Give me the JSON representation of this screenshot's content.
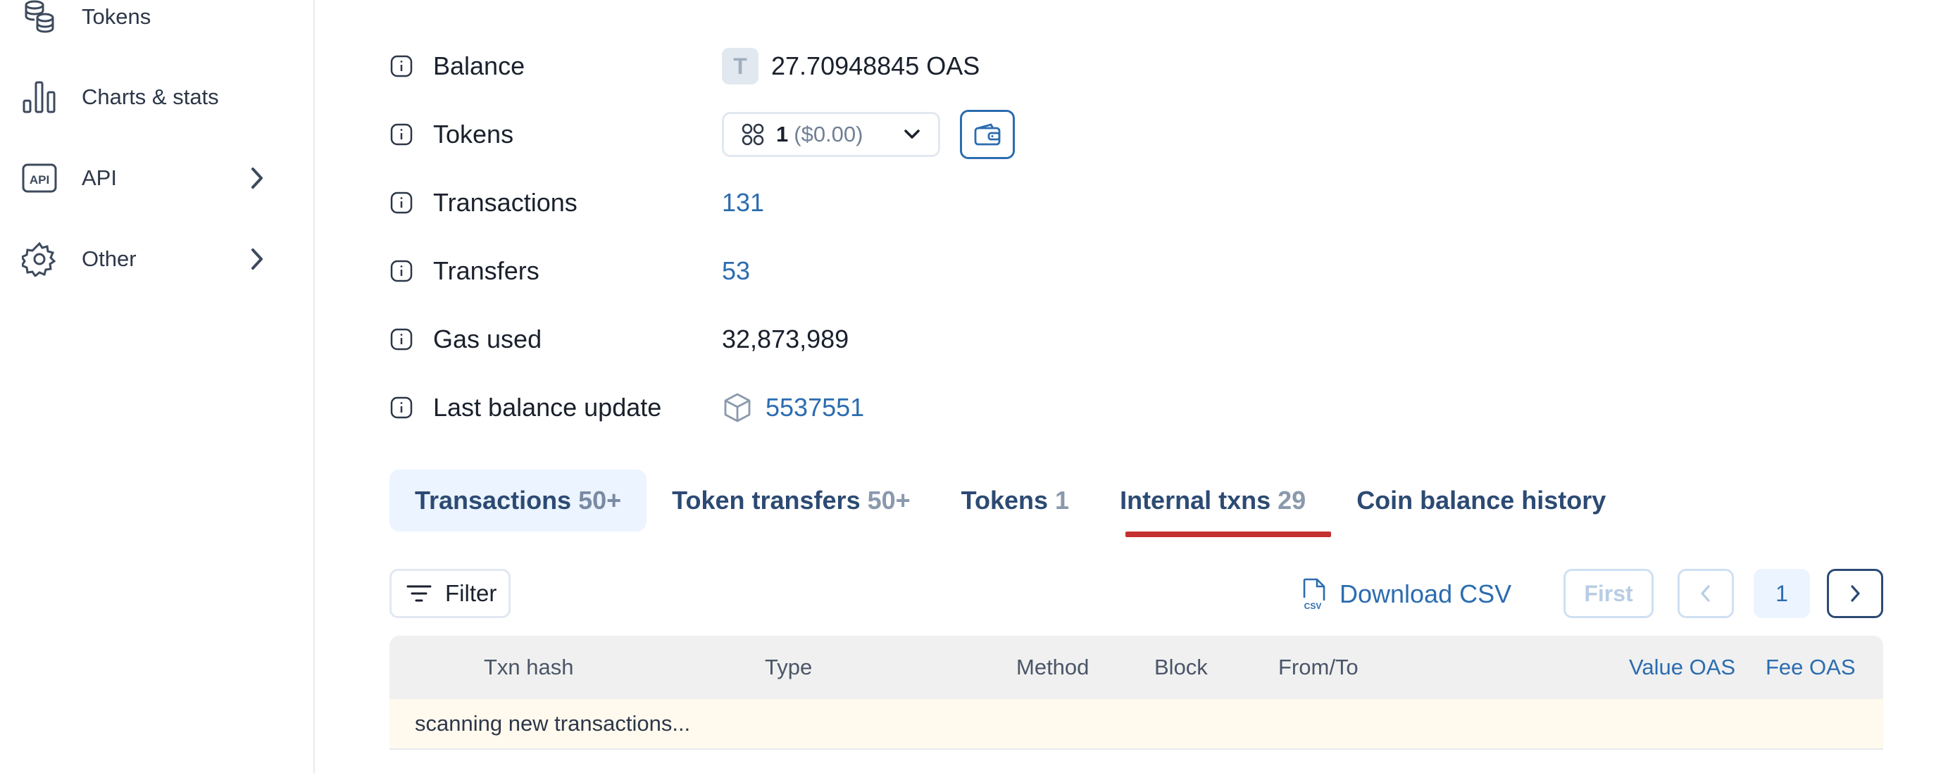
{
  "sidebar": {
    "items": [
      {
        "label": "Tokens",
        "icon": "coins-icon"
      },
      {
        "label": "Charts & stats",
        "icon": "bar-chart-icon"
      },
      {
        "label": "API",
        "icon": "api-icon"
      },
      {
        "label": "Other",
        "icon": "gear-icon"
      }
    ]
  },
  "details": {
    "balance": {
      "label": "Balance",
      "token_letter": "T",
      "value": "27.70948845 OAS"
    },
    "tokens": {
      "label": "Tokens",
      "count": "1",
      "usd": "($0.00)"
    },
    "transactions": {
      "label": "Transactions",
      "value": "131"
    },
    "transfers": {
      "label": "Transfers",
      "value": "53"
    },
    "gas_used": {
      "label": "Gas used",
      "value": "32,873,989"
    },
    "last_balance_update": {
      "label": "Last balance update",
      "value": "5537551"
    }
  },
  "tabs": [
    {
      "label": "Transactions",
      "count": "50+",
      "active": true
    },
    {
      "label": "Token transfers",
      "count": "50+"
    },
    {
      "label": "Tokens",
      "count": "1"
    },
    {
      "label": "Internal txns",
      "count": "29",
      "underlined": true
    },
    {
      "label": "Coin balance history",
      "count": ""
    }
  ],
  "toolbar": {
    "filter_label": "Filter",
    "download_label": "Download CSV",
    "pagination": {
      "first_label": "First",
      "current_page": "1"
    }
  },
  "table": {
    "headers": [
      "Txn hash",
      "Type",
      "Method",
      "Block",
      "From/To",
      "Value OAS",
      "Fee OAS"
    ],
    "status_text": "scanning new transactions..."
  },
  "colors": {
    "link": "#2b6cb0",
    "tab_active_bg": "#ebf4ff",
    "tab_underline": "#c53030",
    "notice_bg": "#fff9ee"
  }
}
